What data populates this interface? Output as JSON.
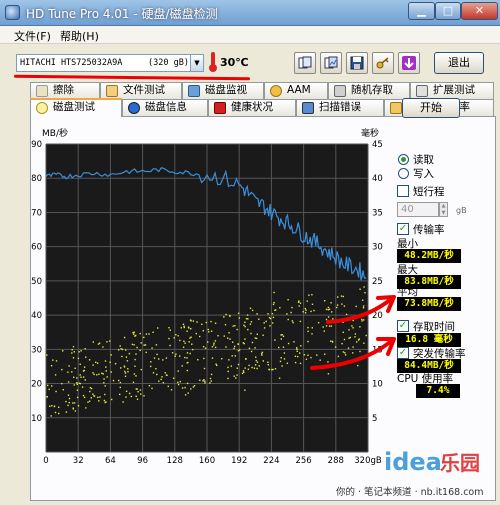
{
  "window": {
    "title": "HD Tune Pro 4.01 - 硬盘/磁盘检测"
  },
  "menu": {
    "file": "文件(F)",
    "help": "帮助(H)"
  },
  "toolbar": {
    "drive_name": "HITACHI HTS725032A9A",
    "drive_capacity": "(320 gB)",
    "temperature": "30℃",
    "exit_label": "退出"
  },
  "tabs_back": [
    "擦除",
    "文件测试",
    "磁盘监视",
    "AAM",
    "随机存取",
    "扩展测试"
  ],
  "tabs_front": [
    "磁盘测试",
    "磁盘信息",
    "健康状况",
    "扫描错误",
    "文件夹使用率"
  ],
  "graph": {
    "left_unit": "MB/秒",
    "right_unit": "毫秒",
    "x_end_label": "320gB"
  },
  "chart_data": {
    "type": "line",
    "title": "",
    "xlabel": "",
    "ylabel": "MB/秒",
    "y2label": "毫秒",
    "xlim": [
      0,
      320
    ],
    "ylim": [
      0,
      90
    ],
    "y2lim": [
      0,
      45
    ],
    "x_ticks": [
      0,
      32,
      64,
      96,
      128,
      160,
      192,
      224,
      256,
      288,
      320
    ],
    "x_tick_labels": [
      "0",
      "32",
      "64",
      "96",
      "128",
      "160",
      "192",
      "224",
      "256",
      "288",
      "320gB"
    ],
    "y_ticks": [
      10,
      20,
      30,
      40,
      50,
      60,
      70,
      80,
      90
    ],
    "y2_ticks": [
      5,
      10,
      15,
      20,
      25,
      30,
      35,
      40,
      45
    ],
    "grid": true,
    "series": [
      {
        "kind": "transfer rate",
        "axis": "left",
        "color": "#3a8fd8",
        "x": [
          0,
          10,
          20,
          32,
          48,
          64,
          80,
          96,
          112,
          128,
          144,
          160,
          176,
          192,
          200,
          208,
          216,
          224,
          232,
          240,
          248,
          256,
          264,
          272,
          280,
          288,
          296,
          304,
          312,
          318
        ],
        "y": [
          80.5,
          81,
          80.5,
          81,
          81.5,
          81,
          82,
          82,
          82.5,
          82,
          81.5,
          81,
          80,
          78,
          76,
          73,
          72,
          70,
          68.5,
          67,
          65.5,
          63.5,
          62,
          60.5,
          58.5,
          57,
          55,
          54,
          53,
          51
        ]
      },
      {
        "kind": "access time",
        "axis": "right",
        "color": "#e6e640",
        "style": "scatter",
        "trend_x": [
          0,
          64,
          128,
          192,
          256,
          320
        ],
        "trend_y": [
          10,
          12,
          14,
          16,
          18,
          20
        ]
      }
    ]
  },
  "controls": {
    "start_label": "开始",
    "read_label": "读取",
    "write_label": "写入",
    "short_stroke_label": "短行程",
    "short_stroke_value": "40",
    "short_stroke_unit": "gB",
    "transfer_label": "传输率",
    "min_label": "最小",
    "min_value": "48.2MB/秒",
    "max_label": "最大",
    "max_value": "83.8MB/秒",
    "avg_label": "平均",
    "avg_value": "73.8MB/秒",
    "access_label": "存取时间",
    "access_value": "16.8 毫秒",
    "burst_label": "突发传输率",
    "burst_value": "84.4MB/秒",
    "cpu_label": "CPU 使用率",
    "cpu_value": "7.4%"
  },
  "watermark": {
    "logo": "idea乐园",
    "caption": "你的 · 笔记本频道 · nb.it168.com"
  },
  "colors": {
    "titlebar": "#6f9fd2",
    "graph_bg": "#1a1a1a",
    "grid": "#555555",
    "annotation": "#e00000"
  }
}
